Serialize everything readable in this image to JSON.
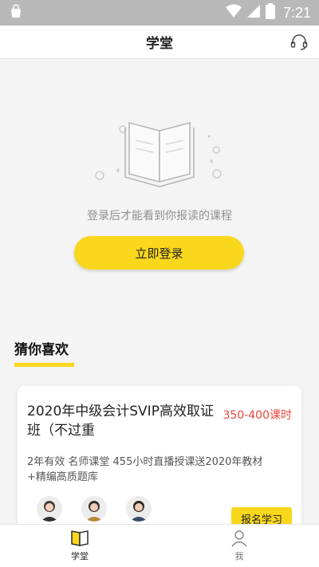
{
  "status_bar": {
    "time": "7:21",
    "icons": [
      "bag-icon",
      "wifi-icon",
      "signal-icon",
      "battery-icon"
    ]
  },
  "header": {
    "title": "学堂",
    "support_icon": "headset-icon"
  },
  "empty_state": {
    "illustration": "open-book-icon",
    "message": "登录后才能看到你报读的课程",
    "login_label": "立即登录"
  },
  "recommend": {
    "title": "猜你喜欢",
    "course": {
      "title": "2020年中级会计SVIP高效取证班（不过重",
      "hours": "350-400课时",
      "desc": "2年有效 名师课堂 455小时直播授课送2020年教材+精编高质题库",
      "enroll_label": "报名学习",
      "teachers": 3
    }
  },
  "tab_bar": {
    "tabs": [
      {
        "label": "学堂",
        "icon": "book-tab-icon",
        "active": true
      },
      {
        "label": "我",
        "icon": "person-tab-icon",
        "active": false
      }
    ]
  },
  "colors": {
    "accent": "#f9d71c",
    "price": "#e8463b",
    "status_bar": "#b8b8b8"
  }
}
